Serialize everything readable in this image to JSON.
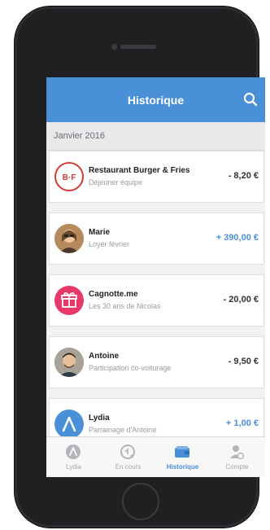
{
  "header": {
    "title": "Historique"
  },
  "section": {
    "label": "Janvier 2016"
  },
  "transactions": [
    {
      "name": "Restaurant Burger & Fries",
      "subtitle": "Déjeuner équipe",
      "amount": "- 8,20 €",
      "kind": "debit",
      "avatar": "restaurant-logo"
    },
    {
      "name": "Marie",
      "subtitle": "Loyer février",
      "amount": "+ 390,00 €",
      "kind": "credit",
      "avatar": "person-photo"
    },
    {
      "name": "Cagnotte.me",
      "subtitle": "Les 30 ans de Nicolas",
      "amount": "- 20,00 €",
      "kind": "debit",
      "avatar": "gift-icon"
    },
    {
      "name": "Antoine",
      "subtitle": "Participation co-voiturage",
      "amount": "- 9,50 €",
      "kind": "debit",
      "avatar": "person-photo"
    },
    {
      "name": "Lydia",
      "subtitle": "Parrainage d'Antoine",
      "amount": "+ 1,00 €",
      "kind": "credit",
      "avatar": "lydia-logo"
    }
  ],
  "tabs": [
    {
      "label": "Lydia",
      "icon": "lydia-icon"
    },
    {
      "label": "En cours",
      "icon": "chat-icon"
    },
    {
      "label": "Historique",
      "icon": "wallet-icon",
      "active": true
    },
    {
      "label": "Compte",
      "icon": "user-icon"
    }
  ],
  "colors": {
    "accent": "#4a90d9",
    "debit_text": "#333333",
    "credit_text": "#4a90d9"
  }
}
